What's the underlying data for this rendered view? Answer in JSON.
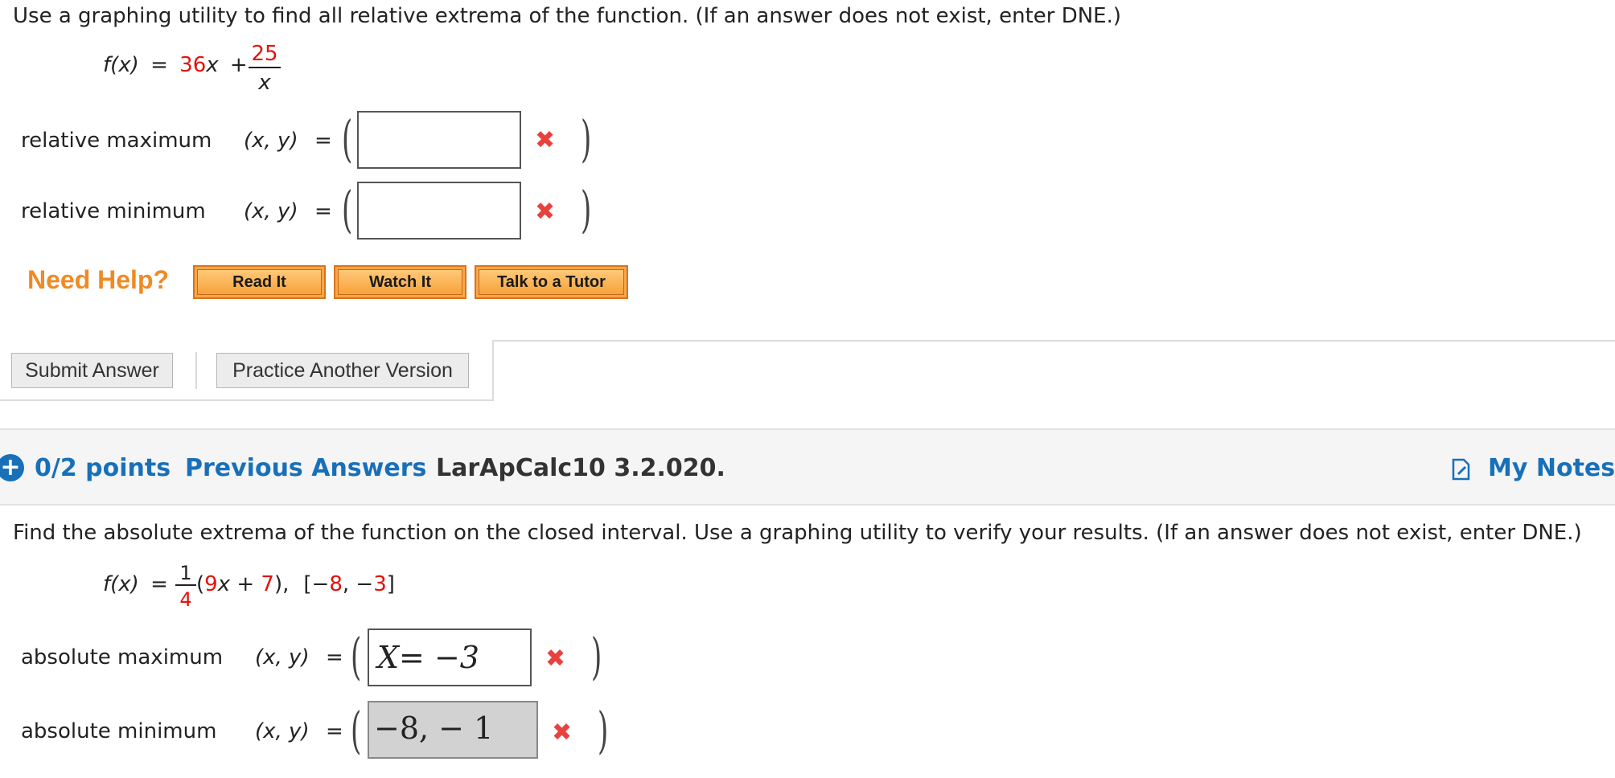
{
  "q1": {
    "instruction": "Use a graphing utility to find all relative extrema of the function. (If an answer does not exist, enter DNE.)",
    "fn_name": "f(x)",
    "fn_eq": "=",
    "fn_coef": "36",
    "fn_x": "x",
    "fn_plus": "+",
    "fn_num": "25",
    "fn_den": "x",
    "rows": [
      {
        "label": "relative maximum",
        "xy": "(x, y)",
        "eq": "=",
        "value": ""
      },
      {
        "label": "relative minimum",
        "xy": "(x, y)",
        "eq": "=",
        "value": ""
      }
    ],
    "need_help": "Need Help?",
    "help_buttons": [
      "Read It",
      "Watch It",
      "Talk to a Tutor"
    ],
    "submit": "Submit Answer",
    "practice": "Practice Another Version"
  },
  "q2_header": {
    "points": "0/2 points",
    "previous": "Previous Answers",
    "code": "LarApCalc10 3.2.020.",
    "notes": "My Notes"
  },
  "q2": {
    "instruction": "Find the absolute extrema of the function on the closed interval. Use a graphing utility to verify your results. (If an answer does not exist, enter DNE.)",
    "fn_name": "f(x)",
    "fn_eq": "=",
    "frac_num": "1",
    "frac_den": "4",
    "open": "(",
    "coef": "9",
    "x": "x",
    "plus": " + ",
    "const": "7",
    "close": "),",
    "interval_open": "[−",
    "a": "8",
    "sep": ", −",
    "b": "3",
    "interval_close": "]",
    "rows": [
      {
        "label": "absolute maximum",
        "xy": "(x, y)",
        "eq": "=",
        "value": "X= −3"
      },
      {
        "label": "absolute minimum",
        "xy": "(x, y)",
        "eq": "=",
        "value": "−8, − 1"
      }
    ]
  },
  "colors": {
    "accent_red": "#e3120b",
    "link_blue": "#1870b9",
    "help_orange": "#f08a24",
    "wrong_mark": "#e8423e"
  },
  "icons": [
    "plus-circle-icon",
    "notes-icon",
    "wrong-x-icon"
  ]
}
